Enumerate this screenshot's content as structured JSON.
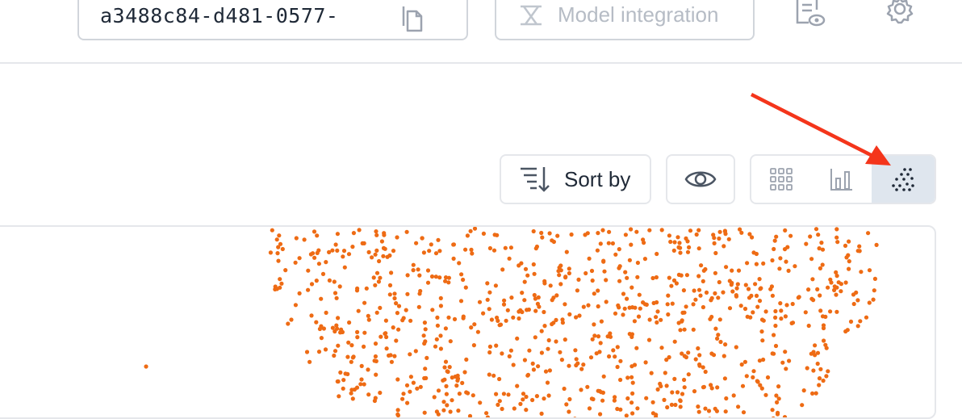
{
  "header": {
    "dataset_id": "a3488c84-d481-0577-",
    "model_integration_label": "Model integration"
  },
  "toolbar": {
    "sort_label": "Sort by"
  },
  "colors": {
    "point": "#ee6b14",
    "arrow": "#f4351b",
    "active_view_bg": "#dfe6ee",
    "border": "#e5e7eb"
  },
  "view_modes": [
    "grid",
    "chart",
    "scatter"
  ],
  "active_view": "scatter"
}
